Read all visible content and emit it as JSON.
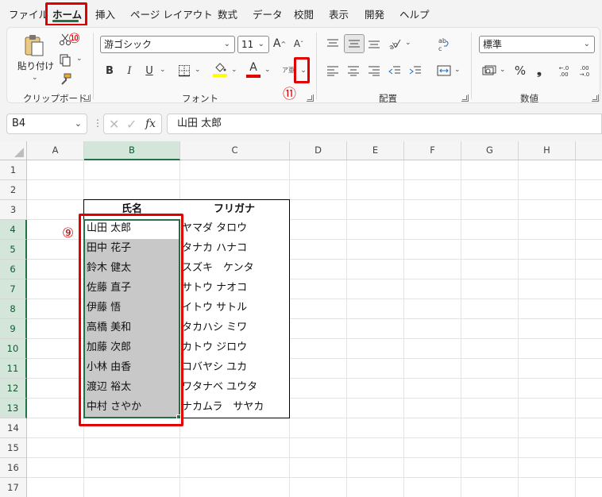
{
  "menu": {
    "tabs": [
      "ファイル",
      "ホーム",
      "挿入",
      "ページ レイアウト",
      "数式",
      "データ",
      "校閲",
      "表示",
      "開発",
      "ヘルプ"
    ],
    "active": "ホーム"
  },
  "ribbon": {
    "clipboard": {
      "paste_label": "貼り付け",
      "group_label": "クリップボード"
    },
    "font": {
      "font_name": "游ゴシック",
      "font_size": "11",
      "group_label": "フォント",
      "bold": "B",
      "italic": "I",
      "underline": "U",
      "phonetic_glyph": "ア亜"
    },
    "alignment": {
      "group_label": "配置"
    },
    "number": {
      "format": "標準",
      "group_label": "数値",
      "percent": "%",
      "comma": "❟",
      "inc_decimal": "←.0 .00",
      "dec_decimal": ".00 →.0"
    },
    "colors": {
      "highlight": "#ffff00",
      "font_color": "#e00000",
      "accent": "#217346"
    }
  },
  "formula_bar": {
    "name_box": "B4",
    "formula": "山田 太郎",
    "fx": "fx"
  },
  "grid": {
    "columns": [
      "A",
      "B",
      "C",
      "D",
      "E",
      "F",
      "G",
      "H"
    ],
    "rows": [
      "1",
      "2",
      "3",
      "4",
      "5",
      "6",
      "7",
      "8",
      "9",
      "10",
      "11",
      "12",
      "13",
      "14",
      "15",
      "16",
      "17"
    ],
    "table": {
      "header_name": "氏名",
      "header_kana": "フリガナ",
      "names": [
        "山田 太郎",
        "田中 花子",
        "鈴木 健太",
        "佐藤 直子",
        "伊藤 悟",
        "高橋 美和",
        "加藤 次郎",
        "小林 由香",
        "渡辺 裕太",
        "中村 さやか"
      ],
      "kana": [
        "ヤマダ タロウ",
        "タナカ ハナコ",
        "スズキ　ケンタ",
        "サトウ ナオコ",
        "イトウ サトル",
        "タカハシ ミワ",
        "カトウ ジロウ",
        "コバヤシ ユカ",
        "ワタナベ ユウタ",
        "ナカムラ　サヤカ"
      ]
    }
  },
  "annotations": {
    "step9": "⑨",
    "step10": "⑩",
    "step11": "⑪"
  }
}
